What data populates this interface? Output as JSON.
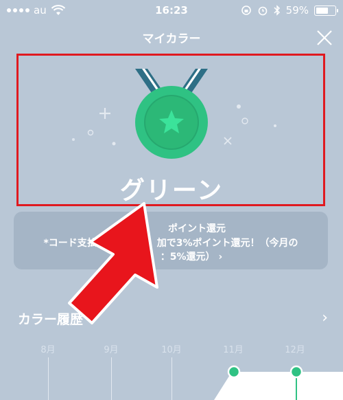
{
  "status_bar": {
    "carrier": "au",
    "time": "16:23",
    "battery": "59%"
  },
  "header": {
    "title": "マイカラー"
  },
  "medal": {
    "color": "#2fc283"
  },
  "color_name": "グリーン",
  "info_card": {
    "title": "ポイント還元",
    "detail": "*コード支払",
    "detail_mid": "加で3%ポイント還元！（今月の",
    "detail_end": "：5%還元）"
  },
  "history": {
    "label": "カラー履歴"
  },
  "months": [
    "8月",
    "9月",
    "10月",
    "11月",
    "12月"
  ],
  "colors": {
    "background": "#b9c7d6",
    "highlight": "#e0191f",
    "arrow": "#e8151c",
    "green": "#2fc283"
  }
}
